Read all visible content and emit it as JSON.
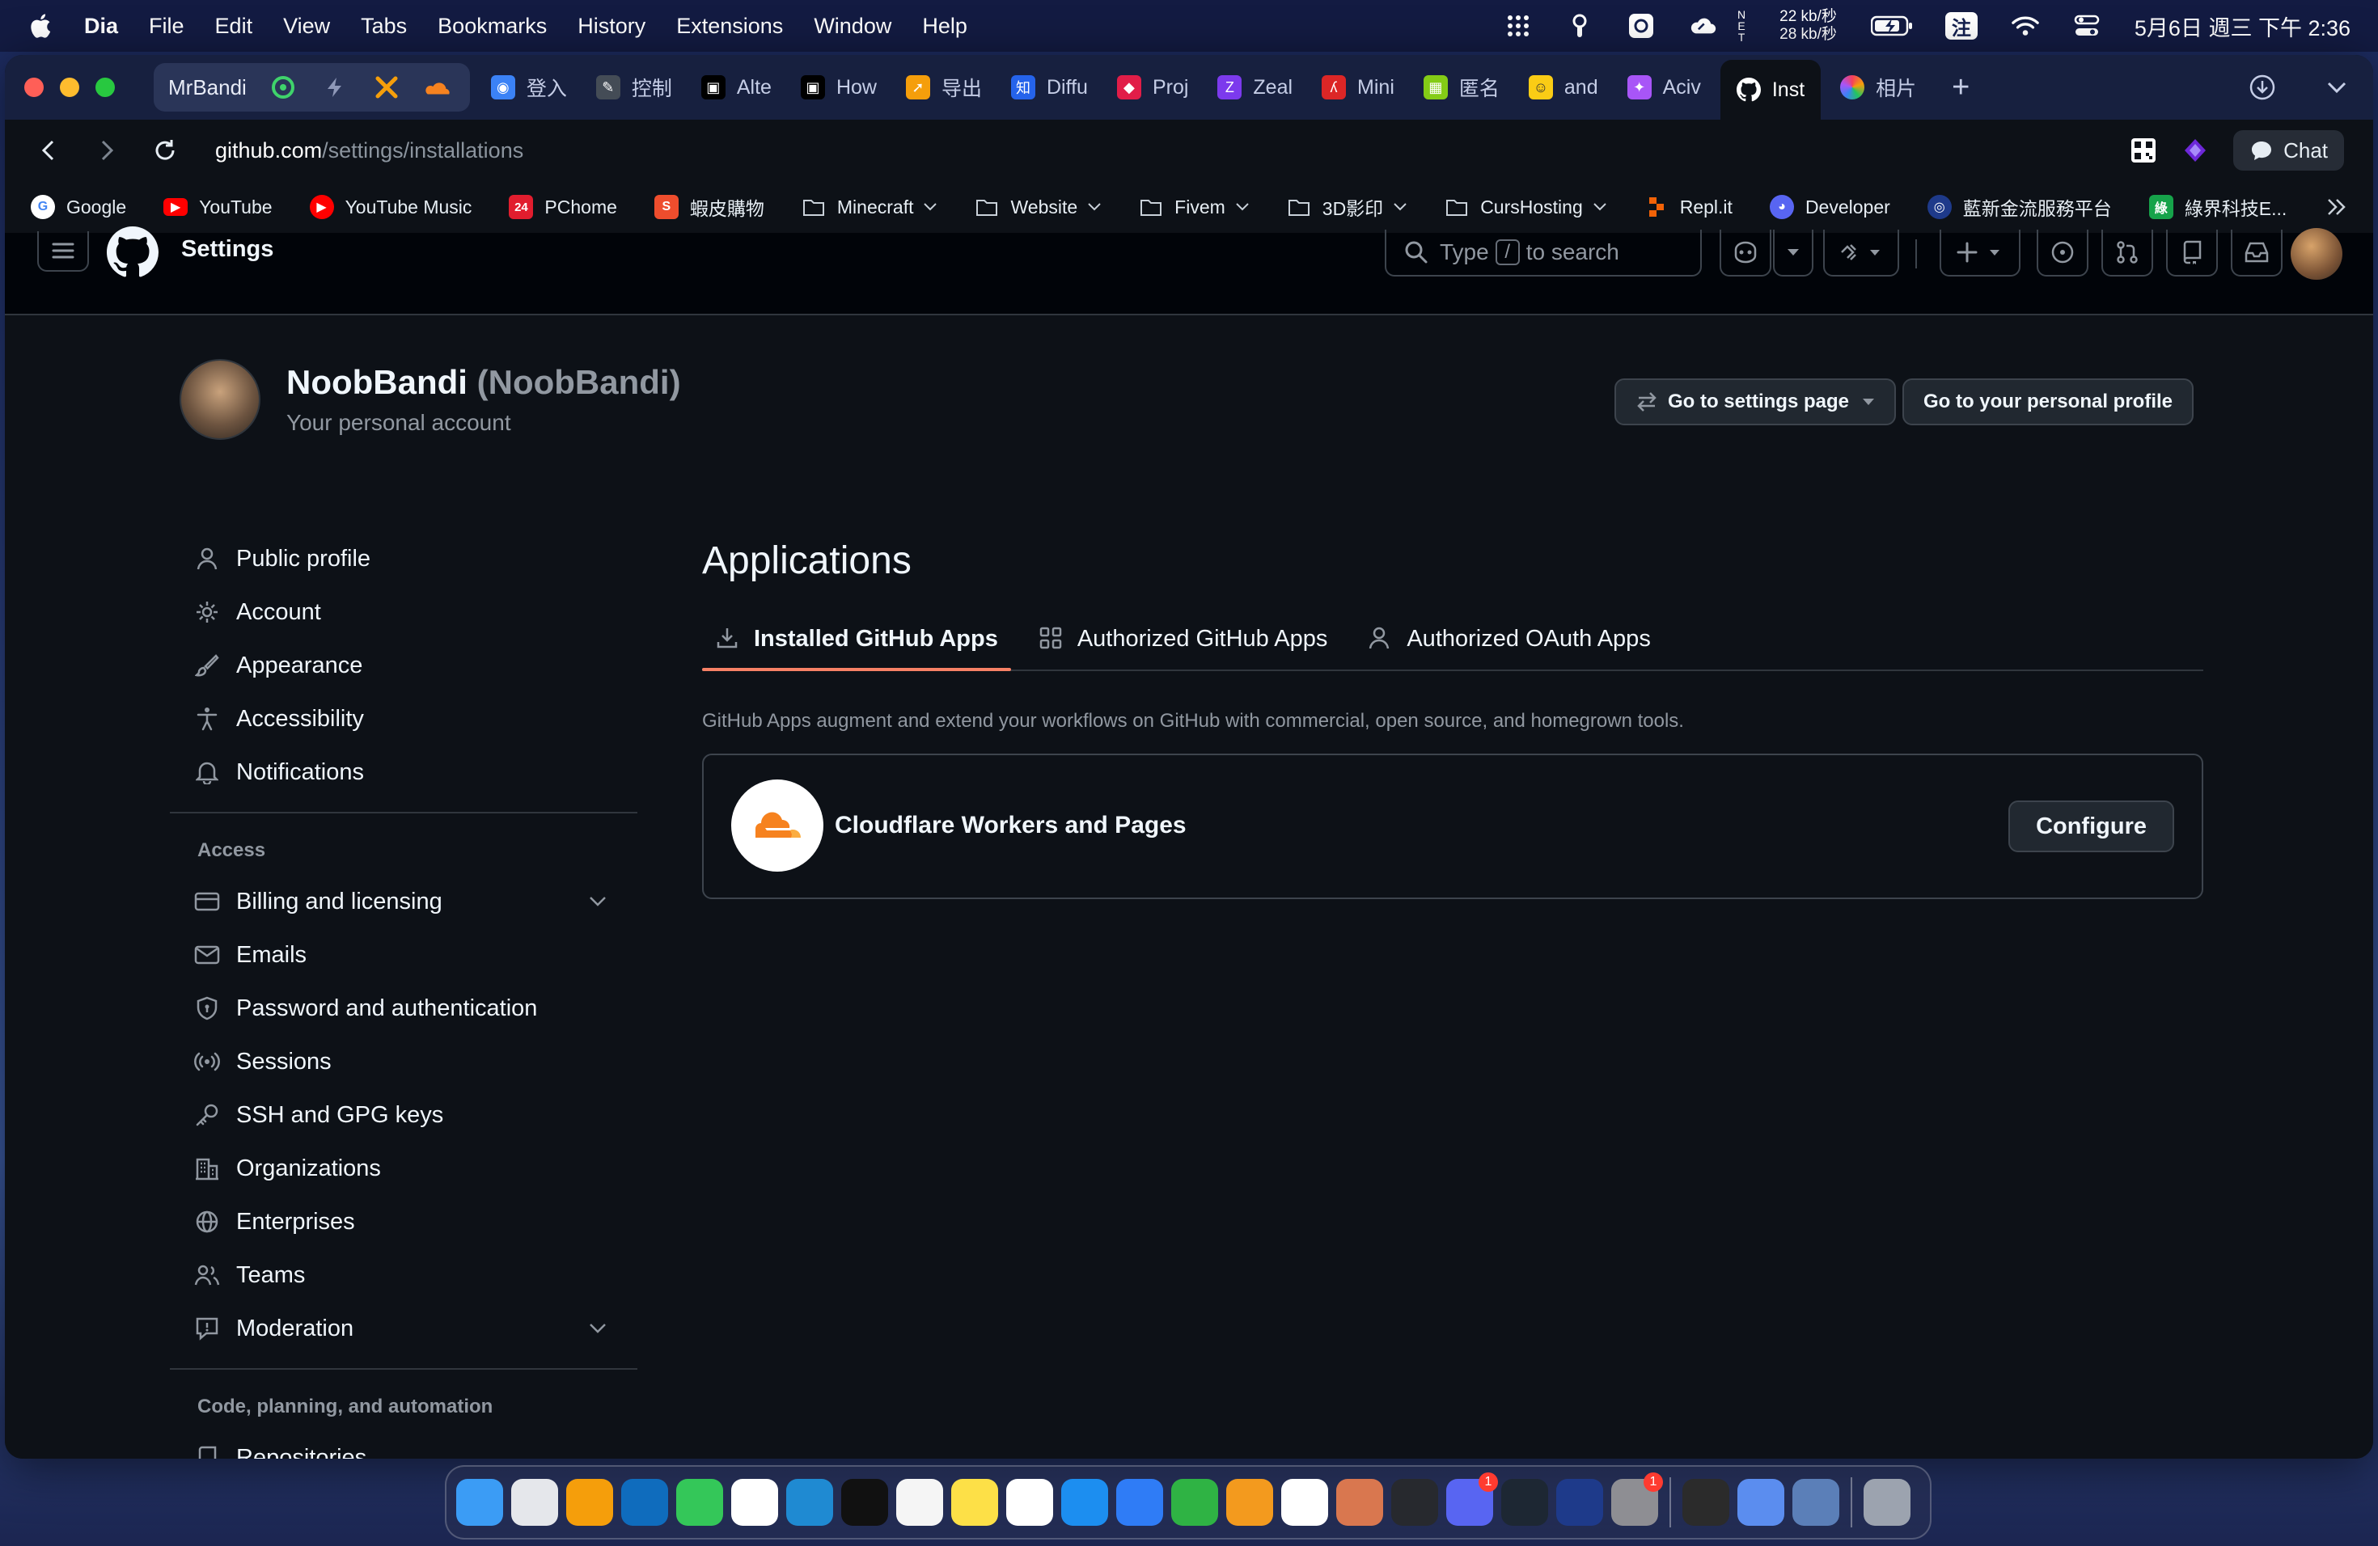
{
  "menubar": {
    "app_name": "Dia",
    "items": [
      "File",
      "Edit",
      "View",
      "Tabs",
      "Bookmarks",
      "History",
      "Extensions",
      "Window",
      "Help"
    ],
    "net_down": "22 kb/秒",
    "net_up": "28 kb/秒",
    "net_n": "N",
    "net_e": "E",
    "net_t": "T",
    "ime": "注",
    "clock": "5月6日 週三 下午 2:36"
  },
  "browser": {
    "group_name": "MrBandi",
    "tabs": [
      {
        "label": "登入",
        "color": "#3b82f6"
      },
      {
        "label": "控制",
        "color": "#444c56"
      },
      {
        "label": "Alte",
        "color": "#222222"
      },
      {
        "label": "How",
        "color": "#222222"
      },
      {
        "label": "导出",
        "color": "#f59e0b"
      },
      {
        "label": "Diffu",
        "color": "#2563eb"
      },
      {
        "label": "Proj",
        "color": "#e11d48"
      },
      {
        "label": "Zeal",
        "color": "#7c3aed"
      },
      {
        "label": "Mini",
        "color": "#dc2626"
      },
      {
        "label": "匿名",
        "color": "#84cc16"
      },
      {
        "label": "and",
        "color": "#facc15"
      },
      {
        "label": "Aciv",
        "color": "#a855f7"
      }
    ],
    "active_tab": "Inst",
    "last_tab": "相片",
    "url_host": "github.com",
    "url_path": "/settings/installations",
    "chat_label": "Chat",
    "bookmarks": [
      {
        "label": "Google",
        "color": "#ffffff",
        "glyph": "G",
        "folder": false
      },
      {
        "label": "YouTube",
        "color": "#ff0000",
        "glyph": "▶",
        "folder": false
      },
      {
        "label": "YouTube Music",
        "color": "#ff0000",
        "glyph": "♪",
        "folder": false
      },
      {
        "label": "PChome",
        "color": "#e11d2e",
        "glyph": "24",
        "folder": false
      },
      {
        "label": "蝦皮購物",
        "color": "#ee4d2d",
        "glyph": "S",
        "folder": false
      },
      {
        "label": "Minecraft",
        "folder": true
      },
      {
        "label": "Website",
        "folder": true
      },
      {
        "label": "Fivem",
        "folder": true
      },
      {
        "label": "3D影印",
        "folder": true
      },
      {
        "label": "CursHosting",
        "folder": true
      },
      {
        "label": "Repl.it",
        "color": "#f26207",
        "glyph": "R",
        "folder": false
      },
      {
        "label": "Developer",
        "color": "#5865f2",
        "glyph": "D",
        "folder": false
      },
      {
        "label": "藍新金流服務平台",
        "color": "#1e3a8a",
        "glyph": "◎",
        "folder": false
      },
      {
        "label": "綠界科技E...",
        "color": "#16a34a",
        "glyph": "綠",
        "folder": false
      }
    ]
  },
  "github": {
    "context": "Settings",
    "search_pre": "Type",
    "search_key": "/",
    "search_post": "to search",
    "user_name": "NoobBandi",
    "user_login": "(NoobBandi)",
    "user_sub": "Your personal account",
    "btn_settings": "Go to settings page",
    "btn_profile": "Go to your personal profile",
    "nav": {
      "public_profile": "Public profile",
      "account": "Account",
      "appearance": "Appearance",
      "accessibility": "Accessibility",
      "notifications": "Notifications",
      "access_head": "Access",
      "billing": "Billing and licensing",
      "emails": "Emails",
      "password": "Password and authentication",
      "sessions": "Sessions",
      "ssh": "SSH and GPG keys",
      "orgs": "Organizations",
      "enterprises": "Enterprises",
      "teams": "Teams",
      "moderation": "Moderation",
      "code_head": "Code, planning, and automation",
      "repos": "Repositories"
    },
    "page_title": "Applications",
    "tabs": {
      "installed": "Installed GitHub Apps",
      "authorized": "Authorized GitHub Apps",
      "oauth": "Authorized OAuth Apps"
    },
    "description": "GitHub Apps augment and extend your workflows on GitHub with commercial, open source, and homegrown tools.",
    "app_name": "Cloudflare Workers and Pages",
    "configure": "Configure",
    "accent": "#f78166"
  },
  "dock": {
    "icons": [
      {
        "name": "finder-icon",
        "color": "#3b9cf5"
      },
      {
        "name": "launchpad-icon",
        "color": "#e5e7eb"
      },
      {
        "name": "arc-icon",
        "color": "#f59e0b"
      },
      {
        "name": "outlook-icon",
        "color": "#0f6cbd"
      },
      {
        "name": "maps-icon",
        "color": "#34c759"
      },
      {
        "name": "calendar-icon",
        "color": "#ffffff"
      },
      {
        "name": "vscode-icon",
        "color": "#1f8ad2"
      },
      {
        "name": "intellij-icon",
        "color": "#111111"
      },
      {
        "name": "reminders-icon",
        "color": "#f5f5f5"
      },
      {
        "name": "notes-icon",
        "color": "#fde047"
      },
      {
        "name": "freeform-icon",
        "color": "#ffffff"
      },
      {
        "name": "keynote-icon",
        "color": "#1c8ef0"
      },
      {
        "name": "appstore-icon",
        "color": "#2f7cf6"
      },
      {
        "name": "numbers-icon",
        "color": "#2fb344"
      },
      {
        "name": "pages-icon",
        "color": "#f39a1e"
      },
      {
        "name": "notion-icon",
        "color": "#ffffff"
      },
      {
        "name": "claude-icon",
        "color": "#d9774f"
      },
      {
        "name": "telegram-icon",
        "color": "#27292e"
      },
      {
        "name": "discord-icon",
        "color": "#5865f2",
        "badge": "1"
      },
      {
        "name": "cloudflare-warp-icon",
        "color": "#1d2733"
      },
      {
        "name": "terminal-icon",
        "color": "#1e3a8a"
      },
      {
        "name": "system-settings-icon",
        "color": "#8e8e93",
        "badge": "1"
      },
      {
        "name": "apps-folder-icon",
        "color": "#2b2b2b"
      },
      {
        "name": "preview-icon",
        "color": "#5b8def"
      },
      {
        "name": "disk-utility-icon",
        "color": "#5b7fb8"
      },
      {
        "name": "trash-icon",
        "color": "#9ca3af"
      }
    ]
  }
}
